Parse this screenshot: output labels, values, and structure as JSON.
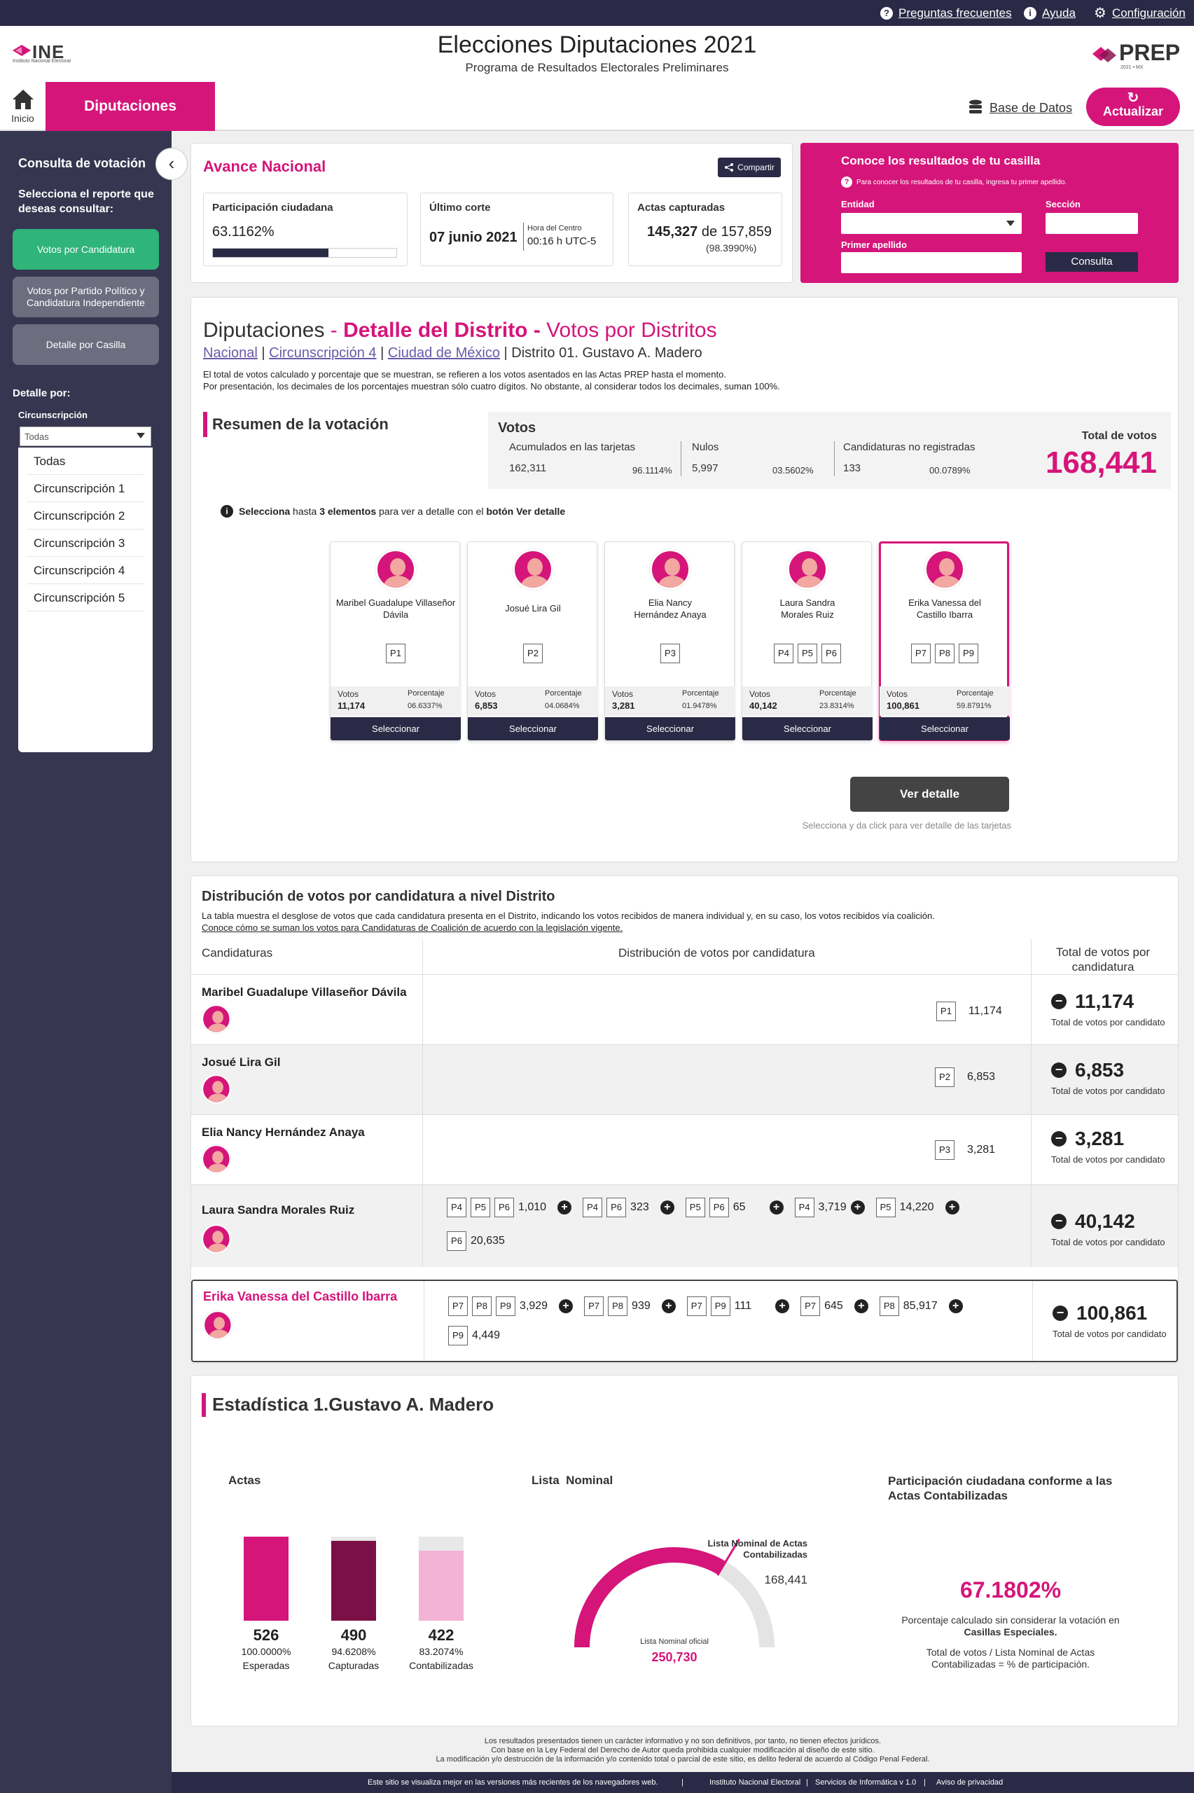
{
  "topbar": {
    "faq": "Preguntas frecuentes",
    "help": "Ayuda",
    "config": "Configuración"
  },
  "header": {
    "logo_ine": "INE",
    "logo_ine_sub": "Instituto Nacional Electoral",
    "title": "Elecciones Diputaciones 2021",
    "subtitle": "Programa de Resultados Electorales Preliminares",
    "logo_prep": "PREP",
    "logo_prep_sub": "2021 • MX"
  },
  "nav": {
    "home": "Inicio",
    "tab": "Diputaciones",
    "database": "Base de Datos",
    "refresh": "Actualizar"
  },
  "sidebar": {
    "title": "Consulta de votación",
    "subtitle": "Selecciona el reporte que deseas consultar:",
    "buttons": [
      "Votos por Candidatura",
      "Votos por Partido Político y Candidatura Independiente",
      "Detalle por Casilla"
    ],
    "detail_by": "Detalle por:",
    "circ_label": "Circunscripción",
    "select_value": "Todas",
    "options": [
      "Todas",
      "Circunscripción 1",
      "Circunscripción 2",
      "Circunscripción 3",
      "Circunscripción 4",
      "Circunscripción 5"
    ]
  },
  "avance": {
    "title": "Avance Nacional",
    "share": "Compartir",
    "participacion_label": "Participación ciudadana",
    "participacion_value": "63.1162%",
    "participacion_fraction": 0.631162,
    "corte_label": "Último corte",
    "corte_date": "07 junio 2021",
    "corte_hora_label": "Hora del Centro",
    "corte_hora": "00:16 h UTC-5",
    "actas_label": "Actas capturadas",
    "actas_value": "145,327",
    "actas_de": "de 157,859",
    "actas_pct": "(98.3990%)"
  },
  "conoce": {
    "title": "Conoce los resultados de tu casilla",
    "note": "Para conocer los resultados de tu casilla, ingresa tu primer apellido.",
    "entidad": "Entidad",
    "seccion": "Sección",
    "apellido": "Primer apellido",
    "button": "Consulta"
  },
  "detalle": {
    "title_a": "Diputaciones",
    "title_sep": " - ",
    "title_b": "Detalle del Distrito -",
    "title_c": " Votos por Distritos",
    "crumb_1": "Nacional",
    "crumb_2": "Circunscripción 4",
    "crumb_3": "Ciudad de México",
    "crumb_4": "Distrito 01. Gustavo A. Madero",
    "sep": "|",
    "note_1": "El total de votos calculado y porcentaje que se muestran, se refieren a los votos asentados en las Actas PREP hasta el momento.",
    "note_2": "Por presentación, los decimales de los porcentajes muestran sólo cuatro dígitos. No obstante, al considerar todos los decimales, suman 100%.",
    "resumen": "Resumen de la votación",
    "votos": "Votos",
    "acum_label": "Acumulados en las tarjetas",
    "acum_value": "162,311",
    "acum_pct": "96.1114%",
    "nulos_label": "Nulos",
    "nulos_value": "5,997",
    "nulos_pct": "03.5602%",
    "noreg_label": "Candidaturas no registradas",
    "noreg_value": "133",
    "noreg_pct": "00.0789%",
    "total_label": "Total de votos",
    "total_value": "168,441",
    "info_a": "Selecciona",
    "info_b": " hasta ",
    "info_c": "3 elementos",
    "info_d": " para ver a detalle con el ",
    "info_e": "botón Ver detalle",
    "votos_col": "Votos",
    "pct_col": "Porcentaje",
    "select_btn": "Seleccionar",
    "ver_detalle": "Ver detalle",
    "ver_detalle_note": "Selecciona y da click para ver detalle de las tarjetas"
  },
  "candidates": [
    {
      "name": "Maribel Guadalupe Villaseñor Dávila",
      "parties": [
        "P1"
      ],
      "votes": "11,174",
      "pct": "06.6337%"
    },
    {
      "name": "Josué Lira Gil",
      "parties": [
        "P2"
      ],
      "votes": "6,853",
      "pct": "04.0684%"
    },
    {
      "name": "Elia Nancy Hernández Anaya",
      "parties": [
        "P3"
      ],
      "votes": "3,281",
      "pct": "01.9478%"
    },
    {
      "name": "Laura Sandra Morales Ruiz",
      "parties": [
        "P4",
        "P5",
        "P6"
      ],
      "votes": "40,142",
      "pct": "23.8314%"
    },
    {
      "name": "Erika Vanessa del Castillo Ibarra",
      "parties": [
        "P7",
        "P8",
        "P9"
      ],
      "votes": "100,861",
      "pct": "59.8791%"
    }
  ],
  "distribucion": {
    "title": "Distribución de votos por candidatura a nivel Distrito",
    "note": "La tabla muestra el desglose de votos que cada candidatura presenta en el Distrito, indicando los votos recibidos de manera individual y, en su caso, los votos recibidos vía coalición.",
    "link": "Conoce cómo se suman los votos para Candidaturas de Coalición de acuerdo con la legislación vigente.",
    "col_1": "Candidaturas",
    "col_2": "Distribución de votos por candidatura",
    "col_3": "Total de votos por candidatura",
    "total_sub": "Total de votos por candidato",
    "rows": [
      {
        "name": "Maribel Guadalupe Villaseñor Dávila",
        "groups": [
          {
            "p": [
              "P1"
            ],
            "v": "11,174"
          }
        ],
        "total": "11,174"
      },
      {
        "name": "Josué Lira Gil",
        "groups": [
          {
            "p": [
              "P2"
            ],
            "v": "6,853"
          }
        ],
        "total": "6,853"
      },
      {
        "name": "Elia Nancy Hernández Anaya",
        "groups": [
          {
            "p": [
              "P3"
            ],
            "v": "3,281"
          }
        ],
        "total": "3,281"
      },
      {
        "name": "Laura Sandra Morales Ruiz",
        "groups": [
          {
            "p": [
              "P4",
              "P5",
              "P6"
            ],
            "v": "1,010"
          },
          {
            "p": [
              "P4",
              "P6"
            ],
            "v": "323"
          },
          {
            "p": [
              "P5",
              "P6"
            ],
            "v": "65"
          },
          {
            "p": [
              "P4"
            ],
            "v": "3,719"
          },
          {
            "p": [
              "P5"
            ],
            "v": "14,220"
          },
          {
            "p": [
              "P6"
            ],
            "v": "20,635"
          }
        ],
        "total": "40,142"
      },
      {
        "name": "Erika Vanessa del Castillo Ibarra",
        "groups": [
          {
            "p": [
              "P7",
              "P8",
              "P9"
            ],
            "v": "3,929"
          },
          {
            "p": [
              "P7",
              "P8"
            ],
            "v": "939"
          },
          {
            "p": [
              "P7",
              "P9"
            ],
            "v": "111"
          },
          {
            "p": [
              "P7"
            ],
            "v": "645"
          },
          {
            "p": [
              "P8"
            ],
            "v": "85,917"
          },
          {
            "p": [
              "P9"
            ],
            "v": "4,449"
          }
        ],
        "total": "100,861"
      }
    ]
  },
  "estadistica": {
    "title": "Estadística 1.Gustavo A. Madero",
    "actas_t": "Actas",
    "lista_t": "Lista  Nominal",
    "part_t": "Participación ciudadana conforme a las Actas Contabilizadas",
    "bars": [
      {
        "num": "526",
        "pct": "100.0000%",
        "label": "Esperadas",
        "fraction": 1.0,
        "color": "#d5157a"
      },
      {
        "num": "490",
        "pct": "94.6208%",
        "label": "Capturadas",
        "fraction": 0.946208,
        "color": "#7a1146"
      },
      {
        "num": "422",
        "pct": "83.2074%",
        "label": "Contabilizadas",
        "fraction": 0.832074,
        "color": "#f2b3d5"
      }
    ],
    "lista_contab_label": "Lista Nominal de Actas Contabilizadas",
    "lista_contab_value": "168,441",
    "lista_oficial_label": "Lista Nominal oficial",
    "lista_oficial_value": "250,730",
    "gauge_fraction": 0.6718,
    "part_value": "67.1802%",
    "part_note_1": "Porcentaje calculado sin considerar la votación en",
    "part_note_2": "Casillas Especiales.",
    "part_note_3": "Total de votos / Lista Nominal de Actas Contabilizadas = % de participación."
  },
  "footer": {
    "line1": "Los resultados presentados tienen un carácter informativo y no son definitivos, por tanto, no tienen efectos jurídicos.",
    "line2": "Con base en la Ley Federal del Derecho de Autor queda prohibida cualquier modificación al diseño de este sitio.",
    "line3": "La modificación y/o destrucción de la información y/o contenido total o parcial de este sitio, es delito federal de acuerdo al Código Penal Federal.",
    "browsers": "Este sitio se visualiza mejor en las versiones más recientes de los navegadores web.",
    "ine": "Instituto Nacional Electoral",
    "servicios": "Servicios de Informática  v 1.0",
    "privacidad": "Aviso de privacidad"
  },
  "colors": {
    "brand": "#d5157a",
    "dark": "#2a2a46",
    "sidebar": "#363650",
    "green": "#2fb47a"
  }
}
